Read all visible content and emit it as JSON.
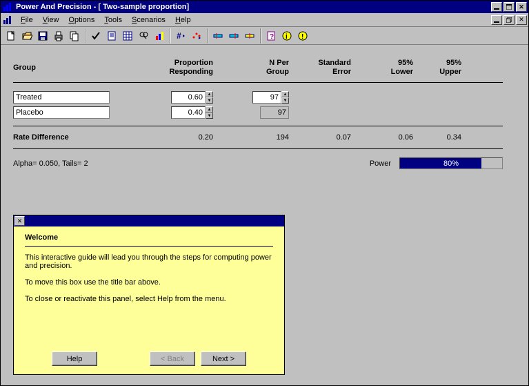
{
  "title": "Power And Precision - [ Two-sample proportion]",
  "menu": [
    "File",
    "View",
    "Options",
    "Tools",
    "Scenarios",
    "Help"
  ],
  "headers": {
    "group": "Group",
    "prop": "Proportion\nResponding",
    "nper": "N Per\nGroup",
    "se": "Standard\nError",
    "low": "95%\nLower",
    "up": "95%\nUpper"
  },
  "rows": [
    {
      "name": "Treated",
      "prop": "0.60",
      "n": "97"
    },
    {
      "name": "Placebo",
      "prop": "0.40",
      "n": "97"
    }
  ],
  "summary": {
    "label": "Rate Difference",
    "diff": "0.20",
    "ntot": "194",
    "se": "0.07",
    "low": "0.06",
    "up": "0.34"
  },
  "alpha": "Alpha= 0.050, Tails= 2",
  "power": {
    "label": "Power",
    "pct": 80,
    "text": "80%"
  },
  "help": {
    "title": "Welcome",
    "p1": "This interactive guide will lead you through the steps for computing power and precision.",
    "p2": "To move this box use the title bar above.",
    "p3": "To close or reactivate this panel, select Help from the menu.",
    "btn_help": "Help",
    "btn_back": "< Back",
    "btn_next": "Next >"
  }
}
